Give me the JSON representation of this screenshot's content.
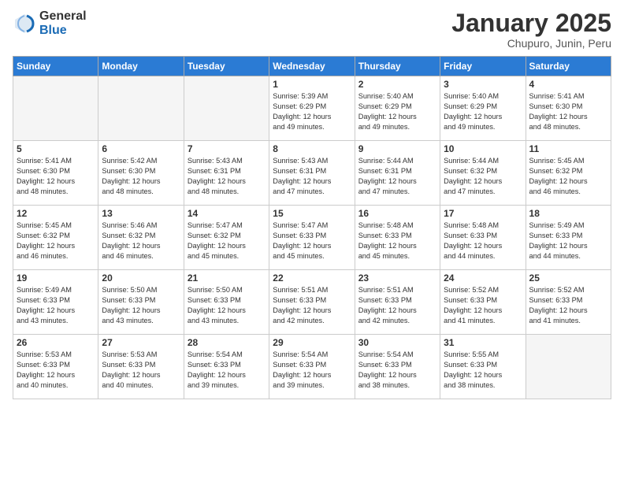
{
  "logo": {
    "general": "General",
    "blue": "Blue"
  },
  "title": "January 2025",
  "subtitle": "Chupuro, Junin, Peru",
  "days_header": [
    "Sunday",
    "Monday",
    "Tuesday",
    "Wednesday",
    "Thursday",
    "Friday",
    "Saturday"
  ],
  "weeks": [
    [
      {
        "day": "",
        "info": ""
      },
      {
        "day": "",
        "info": ""
      },
      {
        "day": "",
        "info": ""
      },
      {
        "day": "1",
        "info": "Sunrise: 5:39 AM\nSunset: 6:29 PM\nDaylight: 12 hours\nand 49 minutes."
      },
      {
        "day": "2",
        "info": "Sunrise: 5:40 AM\nSunset: 6:29 PM\nDaylight: 12 hours\nand 49 minutes."
      },
      {
        "day": "3",
        "info": "Sunrise: 5:40 AM\nSunset: 6:29 PM\nDaylight: 12 hours\nand 49 minutes."
      },
      {
        "day": "4",
        "info": "Sunrise: 5:41 AM\nSunset: 6:30 PM\nDaylight: 12 hours\nand 48 minutes."
      }
    ],
    [
      {
        "day": "5",
        "info": "Sunrise: 5:41 AM\nSunset: 6:30 PM\nDaylight: 12 hours\nand 48 minutes."
      },
      {
        "day": "6",
        "info": "Sunrise: 5:42 AM\nSunset: 6:30 PM\nDaylight: 12 hours\nand 48 minutes."
      },
      {
        "day": "7",
        "info": "Sunrise: 5:43 AM\nSunset: 6:31 PM\nDaylight: 12 hours\nand 48 minutes."
      },
      {
        "day": "8",
        "info": "Sunrise: 5:43 AM\nSunset: 6:31 PM\nDaylight: 12 hours\nand 47 minutes."
      },
      {
        "day": "9",
        "info": "Sunrise: 5:44 AM\nSunset: 6:31 PM\nDaylight: 12 hours\nand 47 minutes."
      },
      {
        "day": "10",
        "info": "Sunrise: 5:44 AM\nSunset: 6:32 PM\nDaylight: 12 hours\nand 47 minutes."
      },
      {
        "day": "11",
        "info": "Sunrise: 5:45 AM\nSunset: 6:32 PM\nDaylight: 12 hours\nand 46 minutes."
      }
    ],
    [
      {
        "day": "12",
        "info": "Sunrise: 5:45 AM\nSunset: 6:32 PM\nDaylight: 12 hours\nand 46 minutes."
      },
      {
        "day": "13",
        "info": "Sunrise: 5:46 AM\nSunset: 6:32 PM\nDaylight: 12 hours\nand 46 minutes."
      },
      {
        "day": "14",
        "info": "Sunrise: 5:47 AM\nSunset: 6:32 PM\nDaylight: 12 hours\nand 45 minutes."
      },
      {
        "day": "15",
        "info": "Sunrise: 5:47 AM\nSunset: 6:33 PM\nDaylight: 12 hours\nand 45 minutes."
      },
      {
        "day": "16",
        "info": "Sunrise: 5:48 AM\nSunset: 6:33 PM\nDaylight: 12 hours\nand 45 minutes."
      },
      {
        "day": "17",
        "info": "Sunrise: 5:48 AM\nSunset: 6:33 PM\nDaylight: 12 hours\nand 44 minutes."
      },
      {
        "day": "18",
        "info": "Sunrise: 5:49 AM\nSunset: 6:33 PM\nDaylight: 12 hours\nand 44 minutes."
      }
    ],
    [
      {
        "day": "19",
        "info": "Sunrise: 5:49 AM\nSunset: 6:33 PM\nDaylight: 12 hours\nand 43 minutes."
      },
      {
        "day": "20",
        "info": "Sunrise: 5:50 AM\nSunset: 6:33 PM\nDaylight: 12 hours\nand 43 minutes."
      },
      {
        "day": "21",
        "info": "Sunrise: 5:50 AM\nSunset: 6:33 PM\nDaylight: 12 hours\nand 43 minutes."
      },
      {
        "day": "22",
        "info": "Sunrise: 5:51 AM\nSunset: 6:33 PM\nDaylight: 12 hours\nand 42 minutes."
      },
      {
        "day": "23",
        "info": "Sunrise: 5:51 AM\nSunset: 6:33 PM\nDaylight: 12 hours\nand 42 minutes."
      },
      {
        "day": "24",
        "info": "Sunrise: 5:52 AM\nSunset: 6:33 PM\nDaylight: 12 hours\nand 41 minutes."
      },
      {
        "day": "25",
        "info": "Sunrise: 5:52 AM\nSunset: 6:33 PM\nDaylight: 12 hours\nand 41 minutes."
      }
    ],
    [
      {
        "day": "26",
        "info": "Sunrise: 5:53 AM\nSunset: 6:33 PM\nDaylight: 12 hours\nand 40 minutes."
      },
      {
        "day": "27",
        "info": "Sunrise: 5:53 AM\nSunset: 6:33 PM\nDaylight: 12 hours\nand 40 minutes."
      },
      {
        "day": "28",
        "info": "Sunrise: 5:54 AM\nSunset: 6:33 PM\nDaylight: 12 hours\nand 39 minutes."
      },
      {
        "day": "29",
        "info": "Sunrise: 5:54 AM\nSunset: 6:33 PM\nDaylight: 12 hours\nand 39 minutes."
      },
      {
        "day": "30",
        "info": "Sunrise: 5:54 AM\nSunset: 6:33 PM\nDaylight: 12 hours\nand 38 minutes."
      },
      {
        "day": "31",
        "info": "Sunrise: 5:55 AM\nSunset: 6:33 PM\nDaylight: 12 hours\nand 38 minutes."
      },
      {
        "day": "",
        "info": ""
      }
    ]
  ]
}
